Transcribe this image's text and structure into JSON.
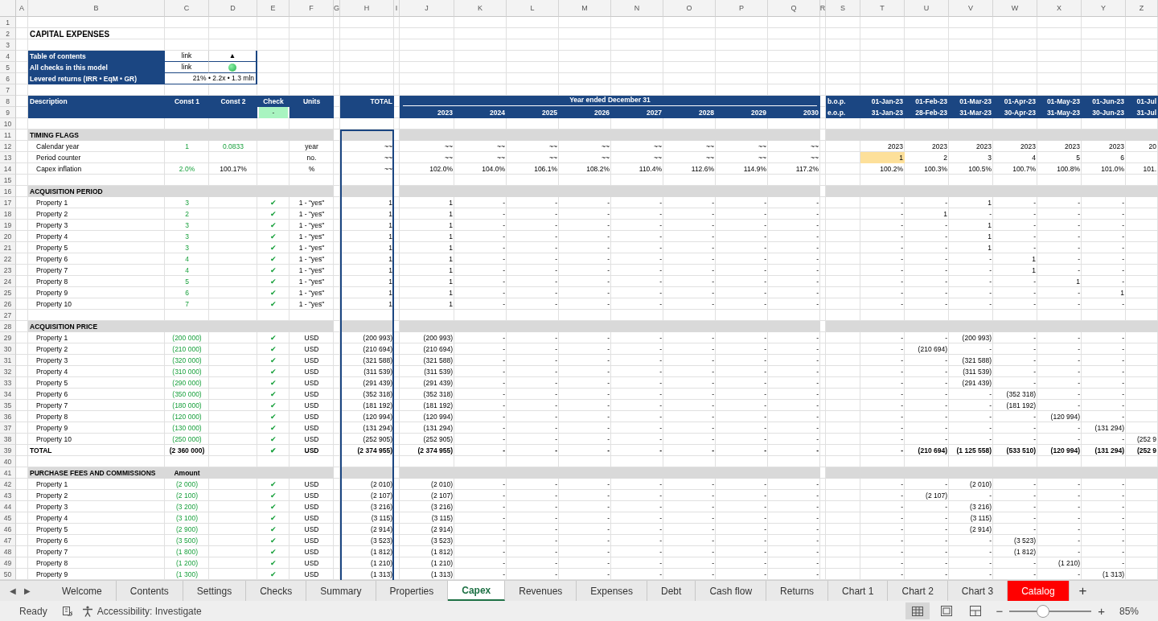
{
  "columns": [
    "A",
    "B",
    "C",
    "D",
    "E",
    "F",
    "G",
    "H",
    "I",
    "J",
    "K",
    "L",
    "M",
    "N",
    "O",
    "P",
    "Q",
    "R",
    "S",
    "T",
    "U",
    "V",
    "W",
    "X",
    "Y",
    "Z"
  ],
  "rows": [
    {
      "num": "1",
      "kind": "blank"
    },
    {
      "num": "2",
      "kind": "title",
      "cells": [
        null,
        "CAPITAL EXPENSES"
      ]
    },
    {
      "num": "3",
      "kind": "blank"
    },
    {
      "num": "4",
      "kind": "toc",
      "cells": [
        null,
        "Table of contents",
        "link",
        "▲"
      ]
    },
    {
      "num": "5",
      "kind": "toc",
      "cells": [
        null,
        "All checks in this model",
        "link",
        {
          "kind": "dot",
          "ok": true
        }
      ]
    },
    {
      "num": "6",
      "kind": "toc",
      "cells": [
        null,
        "Levered returns (IRR • EqM • GR)",
        {
          "text": "21% • 2.2x • 1.3 mln",
          "merged": true
        }
      ]
    },
    {
      "num": "7",
      "kind": "blank"
    },
    {
      "num": "8",
      "kind": "header",
      "cells": [
        null,
        "Description",
        "Const 1",
        "Const 2",
        "Check",
        "Units",
        null,
        "TOTAL",
        null,
        {
          "text": "Year ended December 31",
          "merged": true
        },
        null,
        null,
        null,
        null,
        null,
        null,
        null,
        null,
        "b.o.p.",
        "01-Jan-23",
        "01-Feb-23",
        "01-Mar-23",
        "01-Apr-23",
        "01-May-23",
        "01-Jun-23",
        "01-Jul"
      ]
    },
    {
      "num": "9",
      "kind": "header",
      "cells": [
        null,
        null,
        null,
        null,
        {
          "text": "-",
          "ok": true
        },
        null,
        null,
        null,
        null,
        "2023",
        "2024",
        "2025",
        "2026",
        "2027",
        "2028",
        "2029",
        "2030",
        null,
        "e.o.p.",
        "31-Jan-23",
        "28-Feb-23",
        "31-Mar-23",
        "30-Apr-23",
        "31-May-23",
        "30-Jun-23",
        "31-Jul"
      ]
    },
    {
      "num": "10",
      "kind": "blank"
    },
    {
      "num": "11",
      "kind": "section",
      "cells": [
        null,
        "TIMING FLAGS"
      ]
    },
    {
      "num": "12",
      "kind": "item",
      "cells": [
        null,
        "Calendar year",
        {
          "text": "1",
          "input": true
        },
        {
          "text": "0.0833",
          "input": true
        },
        null,
        "year",
        null,
        "~~",
        null,
        "~~",
        "~~",
        "~~",
        "~~",
        "~~",
        "~~",
        "~~",
        "~~",
        null,
        null,
        "2023",
        "2023",
        "2023",
        "2023",
        "2023",
        "2023",
        "20"
      ]
    },
    {
      "num": "13",
      "kind": "item",
      "cells": [
        null,
        "Period counter",
        null,
        null,
        null,
        "no.",
        null,
        "~~",
        null,
        "~~",
        "~~",
        "~~",
        "~~",
        "~~",
        "~~",
        "~~",
        "~~",
        null,
        null,
        {
          "text": "1",
          "highlight": true
        },
        "2",
        "3",
        "4",
        "5",
        "6"
      ]
    },
    {
      "num": "14",
      "kind": "item",
      "cells": [
        null,
        "Capex inflation",
        {
          "text": "2.0%",
          "input": true
        },
        "100.17%",
        null,
        "%",
        null,
        "~~",
        null,
        "102.0%",
        "104.0%",
        "106.1%",
        "108.2%",
        "110.4%",
        "112.6%",
        "114.9%",
        "117.2%",
        null,
        null,
        "100.2%",
        "100.3%",
        "100.5%",
        "100.7%",
        "100.8%",
        "101.0%",
        "101."
      ]
    },
    {
      "num": "15",
      "kind": "blank"
    },
    {
      "num": "16",
      "kind": "section",
      "cells": [
        null,
        "ACQUISITION PERIOD"
      ]
    },
    {
      "num": "17",
      "kind": "item",
      "cells": [
        null,
        "Property 1",
        {
          "text": "3",
          "input": true
        },
        null,
        {
          "text": "✔",
          "ok": true
        },
        "1 - \"yes\"",
        null,
        "1",
        null,
        "1",
        "-",
        "-",
        "-",
        "-",
        "-",
        "-",
        "-",
        null,
        null,
        "-",
        "-",
        "1",
        "-",
        "-",
        "-"
      ]
    },
    {
      "num": "18",
      "kind": "item",
      "cells": [
        null,
        "Property 2",
        {
          "text": "2",
          "input": true
        },
        null,
        {
          "text": "✔",
          "ok": true
        },
        "1 - \"yes\"",
        null,
        "1",
        null,
        "1",
        "-",
        "-",
        "-",
        "-",
        "-",
        "-",
        "-",
        null,
        null,
        "-",
        "1",
        "-",
        "-",
        "-",
        "-"
      ]
    },
    {
      "num": "19",
      "kind": "item",
      "cells": [
        null,
        "Property 3",
        {
          "text": "3",
          "input": true
        },
        null,
        {
          "text": "✔",
          "ok": true
        },
        "1 - \"yes\"",
        null,
        "1",
        null,
        "1",
        "-",
        "-",
        "-",
        "-",
        "-",
        "-",
        "-",
        null,
        null,
        "-",
        "-",
        "1",
        "-",
        "-",
        "-"
      ]
    },
    {
      "num": "20",
      "kind": "item",
      "cells": [
        null,
        "Property 4",
        {
          "text": "3",
          "input": true
        },
        null,
        {
          "text": "✔",
          "ok": true
        },
        "1 - \"yes\"",
        null,
        "1",
        null,
        "1",
        "-",
        "-",
        "-",
        "-",
        "-",
        "-",
        "-",
        null,
        null,
        "-",
        "-",
        "1",
        "-",
        "-",
        "-"
      ]
    },
    {
      "num": "21",
      "kind": "item",
      "cells": [
        null,
        "Property 5",
        {
          "text": "3",
          "input": true
        },
        null,
        {
          "text": "✔",
          "ok": true
        },
        "1 - \"yes\"",
        null,
        "1",
        null,
        "1",
        "-",
        "-",
        "-",
        "-",
        "-",
        "-",
        "-",
        null,
        null,
        "-",
        "-",
        "1",
        "-",
        "-",
        "-"
      ]
    },
    {
      "num": "22",
      "kind": "item",
      "cells": [
        null,
        "Property 6",
        {
          "text": "4",
          "input": true
        },
        null,
        {
          "text": "✔",
          "ok": true
        },
        "1 - \"yes\"",
        null,
        "1",
        null,
        "1",
        "-",
        "-",
        "-",
        "-",
        "-",
        "-",
        "-",
        null,
        null,
        "-",
        "-",
        "-",
        "1",
        "-",
        "-"
      ]
    },
    {
      "num": "23",
      "kind": "item",
      "cells": [
        null,
        "Property 7",
        {
          "text": "4",
          "input": true
        },
        null,
        {
          "text": "✔",
          "ok": true
        },
        "1 - \"yes\"",
        null,
        "1",
        null,
        "1",
        "-",
        "-",
        "-",
        "-",
        "-",
        "-",
        "-",
        null,
        null,
        "-",
        "-",
        "-",
        "1",
        "-",
        "-"
      ]
    },
    {
      "num": "24",
      "kind": "item",
      "cells": [
        null,
        "Property 8",
        {
          "text": "5",
          "input": true
        },
        null,
        {
          "text": "✔",
          "ok": true
        },
        "1 - \"yes\"",
        null,
        "1",
        null,
        "1",
        "-",
        "-",
        "-",
        "-",
        "-",
        "-",
        "-",
        null,
        null,
        "-",
        "-",
        "-",
        "-",
        "1",
        "-"
      ]
    },
    {
      "num": "25",
      "kind": "item",
      "cells": [
        null,
        "Property 9",
        {
          "text": "6",
          "input": true
        },
        null,
        {
          "text": "✔",
          "ok": true
        },
        "1 - \"yes\"",
        null,
        "1",
        null,
        "1",
        "-",
        "-",
        "-",
        "-",
        "-",
        "-",
        "-",
        null,
        null,
        "-",
        "-",
        "-",
        "-",
        "-",
        "1"
      ]
    },
    {
      "num": "26",
      "kind": "item",
      "cells": [
        null,
        "Property 10",
        {
          "text": "7",
          "input": true
        },
        null,
        {
          "text": "✔",
          "ok": true
        },
        "1 - \"yes\"",
        null,
        "1",
        null,
        "1",
        "-",
        "-",
        "-",
        "-",
        "-",
        "-",
        "-",
        null,
        null,
        "-",
        "-",
        "-",
        "-",
        "-",
        "-"
      ]
    },
    {
      "num": "27",
      "kind": "blank"
    },
    {
      "num": "28",
      "kind": "section",
      "cells": [
        null,
        "ACQUISITION PRICE"
      ]
    },
    {
      "num": "29",
      "kind": "item",
      "cells": [
        null,
        "Property 1",
        {
          "text": "(200 000)",
          "input": true
        },
        null,
        {
          "text": "✔",
          "ok": true
        },
        "USD",
        null,
        "(200 993)",
        null,
        "(200 993)",
        "-",
        "-",
        "-",
        "-",
        "-",
        "-",
        "-",
        null,
        null,
        "-",
        "-",
        "(200 993)",
        "-",
        "-",
        "-"
      ]
    },
    {
      "num": "30",
      "kind": "item",
      "cells": [
        null,
        "Property 2",
        {
          "text": "(210 000)",
          "input": true
        },
        null,
        {
          "text": "✔",
          "ok": true
        },
        "USD",
        null,
        "(210 694)",
        null,
        "(210 694)",
        "-",
        "-",
        "-",
        "-",
        "-",
        "-",
        "-",
        null,
        null,
        "-",
        "(210 694)",
        "-",
        "-",
        "-",
        "-"
      ]
    },
    {
      "num": "31",
      "kind": "item",
      "cells": [
        null,
        "Property 3",
        {
          "text": "(320 000)",
          "input": true
        },
        null,
        {
          "text": "✔",
          "ok": true
        },
        "USD",
        null,
        "(321 588)",
        null,
        "(321 588)",
        "-",
        "-",
        "-",
        "-",
        "-",
        "-",
        "-",
        null,
        null,
        "-",
        "-",
        "(321 588)",
        "-",
        "-",
        "-"
      ]
    },
    {
      "num": "32",
      "kind": "item",
      "cells": [
        null,
        "Property 4",
        {
          "text": "(310 000)",
          "input": true
        },
        null,
        {
          "text": "✔",
          "ok": true
        },
        "USD",
        null,
        "(311 539)",
        null,
        "(311 539)",
        "-",
        "-",
        "-",
        "-",
        "-",
        "-",
        "-",
        null,
        null,
        "-",
        "-",
        "(311 539)",
        "-",
        "-",
        "-"
      ]
    },
    {
      "num": "33",
      "kind": "item",
      "cells": [
        null,
        "Property 5",
        {
          "text": "(290 000)",
          "input": true
        },
        null,
        {
          "text": "✔",
          "ok": true
        },
        "USD",
        null,
        "(291 439)",
        null,
        "(291 439)",
        "-",
        "-",
        "-",
        "-",
        "-",
        "-",
        "-",
        null,
        null,
        "-",
        "-",
        "(291 439)",
        "-",
        "-",
        "-"
      ]
    },
    {
      "num": "34",
      "kind": "item",
      "cells": [
        null,
        "Property 6",
        {
          "text": "(350 000)",
          "input": true
        },
        null,
        {
          "text": "✔",
          "ok": true
        },
        "USD",
        null,
        "(352 318)",
        null,
        "(352 318)",
        "-",
        "-",
        "-",
        "-",
        "-",
        "-",
        "-",
        null,
        null,
        "-",
        "-",
        "-",
        "(352 318)",
        "-",
        "-"
      ]
    },
    {
      "num": "35",
      "kind": "item",
      "cells": [
        null,
        "Property 7",
        {
          "text": "(180 000)",
          "input": true
        },
        null,
        {
          "text": "✔",
          "ok": true
        },
        "USD",
        null,
        "(181 192)",
        null,
        "(181 192)",
        "-",
        "-",
        "-",
        "-",
        "-",
        "-",
        "-",
        null,
        null,
        "-",
        "-",
        "-",
        "(181 192)",
        "-",
        "-"
      ]
    },
    {
      "num": "36",
      "kind": "item",
      "cells": [
        null,
        "Property 8",
        {
          "text": "(120 000)",
          "input": true
        },
        null,
        {
          "text": "✔",
          "ok": true
        },
        "USD",
        null,
        "(120 994)",
        null,
        "(120 994)",
        "-",
        "-",
        "-",
        "-",
        "-",
        "-",
        "-",
        null,
        null,
        "-",
        "-",
        "-",
        "-",
        "(120 994)",
        "-"
      ]
    },
    {
      "num": "37",
      "kind": "item",
      "cells": [
        null,
        "Property 9",
        {
          "text": "(130 000)",
          "input": true
        },
        null,
        {
          "text": "✔",
          "ok": true
        },
        "USD",
        null,
        "(131 294)",
        null,
        "(131 294)",
        "-",
        "-",
        "-",
        "-",
        "-",
        "-",
        "-",
        null,
        null,
        "-",
        "-",
        "-",
        "-",
        "-",
        "(131 294)"
      ]
    },
    {
      "num": "38",
      "kind": "item",
      "cells": [
        null,
        "Property 10",
        {
          "text": "(250 000)",
          "input": true
        },
        null,
        {
          "text": "✔",
          "ok": true
        },
        "USD",
        null,
        "(252 905)",
        null,
        "(252 905)",
        "-",
        "-",
        "-",
        "-",
        "-",
        "-",
        "-",
        null,
        null,
        "-",
        "-",
        "-",
        "-",
        "-",
        "-",
        "(252 9"
      ]
    },
    {
      "num": "39",
      "kind": "total",
      "cells": [
        null,
        "TOTAL",
        "(2 360 000)",
        null,
        {
          "text": "✔",
          "ok": true
        },
        "USD",
        null,
        "(2 374 955)",
        null,
        "(2 374 955)",
        "-",
        "-",
        "-",
        "-",
        "-",
        "-",
        "-",
        null,
        null,
        "-",
        "(210 694)",
        "(1 125 558)",
        "(533 510)",
        "(120 994)",
        "(131 294)",
        "(252 9"
      ]
    },
    {
      "num": "40",
      "kind": "blank"
    },
    {
      "num": "41",
      "kind": "section",
      "cells": [
        null,
        "PURCHASE FEES  AND COMMISSIONS",
        "Amount"
      ]
    },
    {
      "num": "42",
      "kind": "item",
      "cells": [
        null,
        "Property 1",
        {
          "text": "(2 000)",
          "input": true
        },
        null,
        {
          "text": "✔",
          "ok": true
        },
        "USD",
        null,
        "(2 010)",
        null,
        "(2 010)",
        "-",
        "-",
        "-",
        "-",
        "-",
        "-",
        "-",
        null,
        null,
        "-",
        "-",
        "(2 010)",
        "-",
        "-",
        "-"
      ]
    },
    {
      "num": "43",
      "kind": "item",
      "cells": [
        null,
        "Property 2",
        {
          "text": "(2 100)",
          "input": true
        },
        null,
        {
          "text": "✔",
          "ok": true
        },
        "USD",
        null,
        "(2 107)",
        null,
        "(2 107)",
        "-",
        "-",
        "-",
        "-",
        "-",
        "-",
        "-",
        null,
        null,
        "-",
        "(2 107)",
        "-",
        "-",
        "-",
        "-"
      ]
    },
    {
      "num": "44",
      "kind": "item",
      "cells": [
        null,
        "Property 3",
        {
          "text": "(3 200)",
          "input": true
        },
        null,
        {
          "text": "✔",
          "ok": true
        },
        "USD",
        null,
        "(3 216)",
        null,
        "(3 216)",
        "-",
        "-",
        "-",
        "-",
        "-",
        "-",
        "-",
        null,
        null,
        "-",
        "-",
        "(3 216)",
        "-",
        "-",
        "-"
      ]
    },
    {
      "num": "45",
      "kind": "item",
      "cells": [
        null,
        "Property 4",
        {
          "text": "(3 100)",
          "input": true
        },
        null,
        {
          "text": "✔",
          "ok": true
        },
        "USD",
        null,
        "(3 115)",
        null,
        "(3 115)",
        "-",
        "-",
        "-",
        "-",
        "-",
        "-",
        "-",
        null,
        null,
        "-",
        "-",
        "(3 115)",
        "-",
        "-",
        "-"
      ]
    },
    {
      "num": "46",
      "kind": "item",
      "cells": [
        null,
        "Property 5",
        {
          "text": "(2 900)",
          "input": true
        },
        null,
        {
          "text": "✔",
          "ok": true
        },
        "USD",
        null,
        "(2 914)",
        null,
        "(2 914)",
        "-",
        "-",
        "-",
        "-",
        "-",
        "-",
        "-",
        null,
        null,
        "-",
        "-",
        "(2 914)",
        "-",
        "-",
        "-"
      ]
    },
    {
      "num": "47",
      "kind": "item",
      "cells": [
        null,
        "Property 6",
        {
          "text": "(3 500)",
          "input": true
        },
        null,
        {
          "text": "✔",
          "ok": true
        },
        "USD",
        null,
        "(3 523)",
        null,
        "(3 523)",
        "-",
        "-",
        "-",
        "-",
        "-",
        "-",
        "-",
        null,
        null,
        "-",
        "-",
        "-",
        "(3 523)",
        "-",
        "-"
      ]
    },
    {
      "num": "48",
      "kind": "item",
      "cells": [
        null,
        "Property 7",
        {
          "text": "(1 800)",
          "input": true
        },
        null,
        {
          "text": "✔",
          "ok": true
        },
        "USD",
        null,
        "(1 812)",
        null,
        "(1 812)",
        "-",
        "-",
        "-",
        "-",
        "-",
        "-",
        "-",
        null,
        null,
        "-",
        "-",
        "-",
        "(1 812)",
        "-",
        "-"
      ]
    },
    {
      "num": "49",
      "kind": "item",
      "cells": [
        null,
        "Property 8",
        {
          "text": "(1 200)",
          "input": true
        },
        null,
        {
          "text": "✔",
          "ok": true
        },
        "USD",
        null,
        "(1 210)",
        null,
        "(1 210)",
        "-",
        "-",
        "-",
        "-",
        "-",
        "-",
        "-",
        null,
        null,
        "-",
        "-",
        "-",
        "-",
        "(1 210)",
        "-"
      ]
    },
    {
      "num": "50",
      "kind": "item",
      "cells": [
        null,
        "Property 9",
        {
          "text": "(1 300)",
          "input": true
        },
        null,
        {
          "text": "✔",
          "ok": true
        },
        "USD",
        null,
        "(1 313)",
        null,
        "(1 313)",
        "-",
        "-",
        "-",
        "-",
        "-",
        "-",
        "-",
        null,
        null,
        "-",
        "-",
        "-",
        "-",
        "-",
        "(1 313)"
      ]
    }
  ],
  "tab_bar": {
    "nav": [
      "◀",
      "▶"
    ],
    "add": "+",
    "tabs": [
      {
        "label": "Welcome",
        "selected": false
      },
      {
        "label": "Contents",
        "selected": false
      },
      {
        "label": "Settings",
        "selected": false
      },
      {
        "label": "Checks",
        "selected": false
      },
      {
        "label": "Summary",
        "selected": false
      },
      {
        "label": "Properties",
        "selected": false
      },
      {
        "label": "Capex",
        "selected": true
      },
      {
        "label": "Revenues",
        "selected": false
      },
      {
        "label": "Expenses",
        "selected": false
      },
      {
        "label": "Debt",
        "selected": false
      },
      {
        "label": "Cash flow",
        "selected": false
      },
      {
        "label": "Returns",
        "selected": false
      },
      {
        "label": "Chart 1",
        "selected": false
      },
      {
        "label": "Chart 2",
        "selected": false
      },
      {
        "label": "Chart 3",
        "selected": false
      },
      {
        "label": "Catalog",
        "selected": false,
        "color": "#ff0000"
      }
    ]
  },
  "status_bar": {
    "mode": "Ready",
    "accessibility": "Accessibility: Investigate",
    "views": [
      {
        "kind": "normal",
        "selected": true
      },
      {
        "kind": "page_layout",
        "selected": false
      },
      {
        "kind": "page_break",
        "selected": false
      }
    ],
    "zoom_out": "−",
    "zoom_in": "+",
    "zoom": {
      "level": 0.41
    },
    "zoom_label": "85%"
  }
}
